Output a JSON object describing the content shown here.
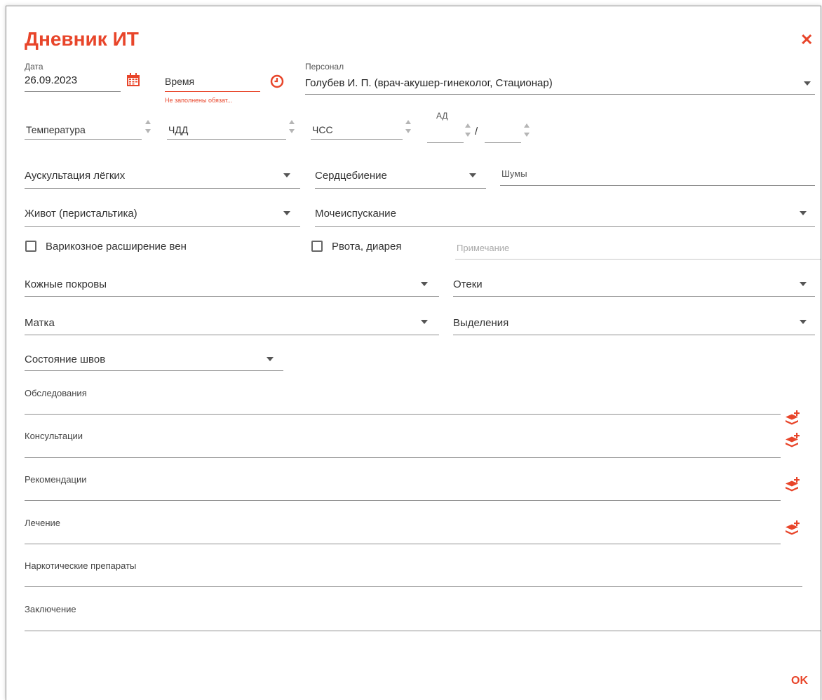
{
  "dialog": {
    "title": "Дневник ИТ",
    "ok_label": "OK",
    "accent_color": "#e8452a"
  },
  "date": {
    "label": "Дата",
    "value": "26.09.2023"
  },
  "time": {
    "label": "Время",
    "error": "Не заполнены обязат..."
  },
  "staff": {
    "label": "Персонал",
    "value": "Голубев И. П.  (врач-акушер-гинеколог, Стационар)"
  },
  "vitals": {
    "temperature": "Температура",
    "rr": "ЧДД",
    "hr": "ЧСС",
    "bp_label": "АД",
    "bp_separator": "/"
  },
  "fields": {
    "lungs": "Аускультация лёгких",
    "heartbeat": "Сердцебиение",
    "noise": "Шумы",
    "abdomen": "Живот (перистальтика)",
    "urination": "Мочеиспускание",
    "varicose": "Варикозное расширение вен",
    "vomit": "Рвота, диарея",
    "note_placeholder": "Примечание",
    "skin": "Кожные покровы",
    "edema": "Отеки",
    "uterus": "Матка",
    "discharge": "Выделения",
    "sutures": "Состояние швов"
  },
  "sections": {
    "exams": "Обследования",
    "consults": "Консультации",
    "recommend": "Рекомендации",
    "treatment": "Лечение",
    "narcotic": "Наркотические препараты",
    "conclusion": "Заключение"
  },
  "icons": {
    "calendar": "calendar-icon",
    "clock": "clock-icon",
    "add": "add-layers-icon",
    "close": "close-icon"
  }
}
